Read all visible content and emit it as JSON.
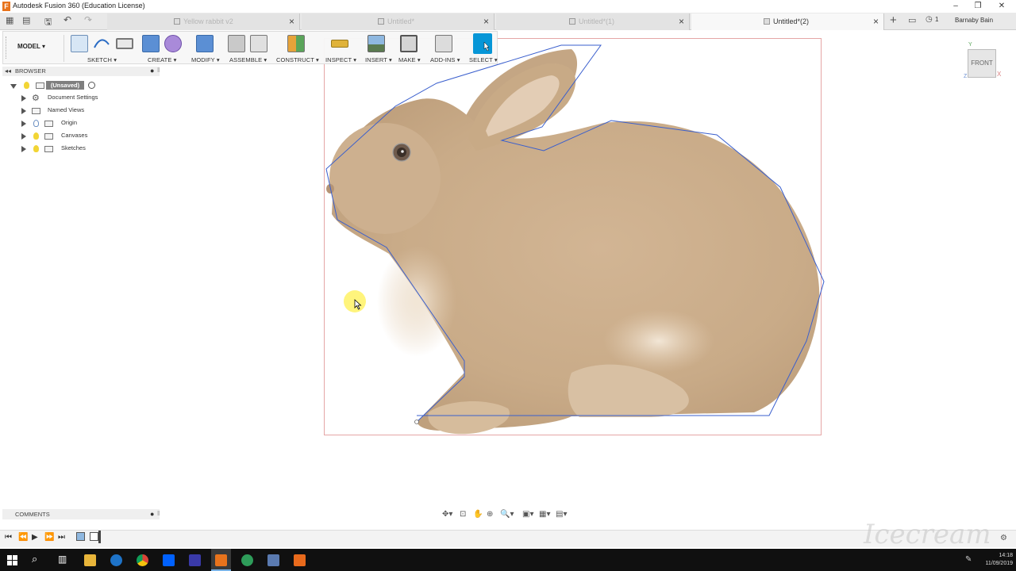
{
  "window": {
    "title": "Autodesk Fusion 360 (Education License)",
    "user": "Barnaby Bain",
    "notifications": "1"
  },
  "tabs": [
    {
      "label": "Yellow rabbit v2",
      "active": false
    },
    {
      "label": "Untitled*",
      "active": false
    },
    {
      "label": "Untitled*(1)",
      "active": false
    },
    {
      "label": "Untitled*(2)",
      "active": true
    }
  ],
  "toolbar": {
    "workspace": "MODEL",
    "groups": {
      "sketch": "SKETCH",
      "create": "CREATE",
      "modify": "MODIFY",
      "assemble": "ASSEMBLE",
      "construct": "CONSTRUCT",
      "inspect": "INSPECT",
      "insert": "INSERT",
      "make": "MAKE",
      "addins": "ADD-INS",
      "select": "SELECT"
    }
  },
  "browser": {
    "title": "BROWSER",
    "root": "(Unsaved)",
    "items": [
      {
        "label": "Document Settings",
        "icon": "gear-icon"
      },
      {
        "label": "Named Views",
        "icon": "folder-icon"
      },
      {
        "label": "Origin",
        "icon": "folder-icon"
      },
      {
        "label": "Canvases",
        "icon": "folder-icon"
      },
      {
        "label": "Sketches",
        "icon": "folder-icon"
      }
    ]
  },
  "viewcube": {
    "face": "FRONT"
  },
  "comments": {
    "title": "COMMENTS"
  },
  "taskbar": {
    "time": "14:18",
    "date": "11/09/2019"
  },
  "watermark": "Icecream",
  "colors": {
    "accent": "#0696d7",
    "sketch_line": "#3a5fcd",
    "canvas_border": "#e5a6a6"
  }
}
